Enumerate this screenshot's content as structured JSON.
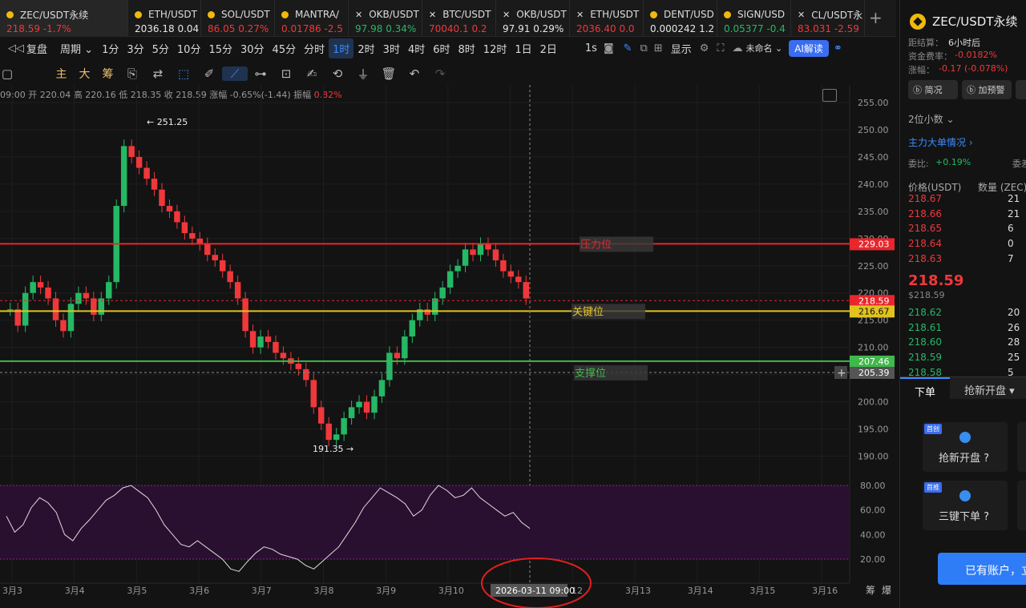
{
  "tickers": [
    {
      "name": "ZEC/USDT永续",
      "price": "218.59",
      "change": "-1.7%",
      "pc": "dn",
      "icon": "coin-icon",
      "active": true,
      "w": 160
    },
    {
      "name": "ETH/USDT",
      "price": "2036.18",
      "change": "0.04",
      "pc": "wh",
      "icon": "coin-icon",
      "w": 91
    },
    {
      "name": "SOL/USDT",
      "price": "86.05",
      "change": "0.27%",
      "pc": "dn",
      "icon": "coin-icon",
      "w": 92
    },
    {
      "name": "MANTRA/",
      "price": "0.01786",
      "change": "-2.5",
      "pc": "dn",
      "icon": "coin-icon",
      "w": 92
    },
    {
      "name": "OKB/USDT",
      "price": "97.98",
      "change": "0.34%",
      "pc": "up",
      "icon": "close-icon",
      "w": 92
    },
    {
      "name": "BTC/USDT",
      "price": "70040.1",
      "change": "0.2",
      "pc": "dn",
      "icon": "close-icon",
      "w": 92
    },
    {
      "name": "OKB/USDT",
      "price": "97.91",
      "change": "0.29%",
      "pc": "wh",
      "icon": "close-icon",
      "w": 92
    },
    {
      "name": "ETH/USDT",
      "price": "2036.40",
      "change": "0.0",
      "pc": "dn",
      "icon": "close-icon",
      "w": 92
    },
    {
      "name": "DENT/USD",
      "price": "0.000242",
      "change": "1.2",
      "pc": "wh",
      "icon": "coin-icon",
      "w": 92
    },
    {
      "name": "SIGN/USD",
      "price": "0.05377",
      "change": "-0.4",
      "pc": "up",
      "icon": "coin-icon",
      "w": 92
    },
    {
      "name": "CL/USDT永",
      "price": "83.031",
      "change": "-2.59",
      "pc": "dn",
      "icon": "close-icon",
      "w": 92
    }
  ],
  "toolbar": {
    "replay": "复盘",
    "period": "周期",
    "intervals": [
      "1分",
      "3分",
      "5分",
      "10分",
      "15分",
      "30分",
      "45分",
      "分时",
      "1时",
      "2时",
      "3时",
      "4时",
      "6时",
      "8时",
      "12时",
      "1日",
      "2日"
    ],
    "selected_interval": "1时",
    "sec": "1s",
    "display": "显示",
    "account": "未命名",
    "ai": "AI解读"
  },
  "tools": {
    "zhu": "主",
    "da": "大",
    "chou": "筹"
  },
  "ohlc": {
    "time": "09:00",
    "open_l": "开",
    "open": "220.04",
    "high_l": "高",
    "high": "220.16",
    "low_l": "低",
    "low": "218.35",
    "close_l": "收",
    "close": "218.59",
    "chg_l": "涨幅",
    "chg": "-0.65%(-1.44)",
    "amp_l": "振幅",
    "amp": "0.82%"
  },
  "chart_data": {
    "type": "candlestick",
    "y_ticks": [
      "255.00",
      "250.00",
      "245.00",
      "240.00",
      "235.00",
      "230.00",
      "225.00",
      "220.00",
      "215.00",
      "210.00",
      "205.00",
      "200.00",
      "195.00",
      "190.00"
    ],
    "x_ticks": [
      "3月3",
      "3月4",
      "3月5",
      "3月6",
      "3月7",
      "3月8",
      "3月9",
      "3月10",
      "3月11",
      "3月12",
      "3月13",
      "3月14",
      "3月15",
      "3月16"
    ],
    "visible_x_ticks": [
      "3月3",
      "3月4",
      "3月5",
      "3月6",
      "3月7",
      "3月8",
      "3月9",
      "3月10",
      "12",
      "3月13",
      "3月14",
      "3月15",
      "3月16"
    ],
    "high_mark": "← 251.25",
    "low_mark": "191.35 →",
    "close": [
      217,
      214,
      220,
      222,
      221,
      219,
      215,
      213,
      218,
      220,
      219,
      216,
      219,
      222,
      236,
      247,
      245,
      243,
      241,
      239,
      236,
      235,
      233,
      231,
      230,
      229,
      227,
      226,
      224,
      222,
      219,
      213,
      210,
      212,
      211,
      209,
      208,
      207,
      206,
      204,
      199,
      196,
      193,
      194,
      197,
      199,
      200,
      198,
      201,
      204,
      209,
      208,
      212,
      215,
      217,
      216,
      219,
      221,
      224,
      225,
      228,
      227,
      229,
      228,
      226,
      224,
      223,
      222,
      219
    ],
    "lines": [
      {
        "price": "229.03",
        "label": "压力位",
        "color": "#e8262b",
        "text_color": "#e8262b"
      },
      {
        "price": "218.59",
        "label": "",
        "color": "#e8262b",
        "dashed": true
      },
      {
        "price": "216.67",
        "label": "关键位",
        "color": "#e0c31f",
        "text_color": "#e8c52c"
      },
      {
        "price": "207.46",
        "label": "",
        "color": "#3fb94a"
      },
      {
        "price": "205.39",
        "label": "支撑位",
        "color": "#888",
        "dashed": true,
        "text_color": "#3fb94a"
      }
    ],
    "cursor_time": "2026-03-11 09:00",
    "osc_ticks": [
      "80.00",
      "60.00",
      "40.00",
      "20.00"
    ],
    "osc": [
      55,
      42,
      48,
      62,
      70,
      66,
      58,
      40,
      35,
      45,
      52,
      60,
      68,
      72,
      78,
      80,
      75,
      70,
      60,
      48,
      40,
      32,
      30,
      35,
      30,
      25,
      20,
      12,
      10,
      18,
      25,
      30,
      28,
      24,
      22,
      20,
      15,
      12,
      18,
      24,
      30,
      40,
      50,
      62,
      70,
      78,
      74,
      70,
      65,
      55,
      60,
      72,
      80,
      76,
      70,
      72,
      78,
      70,
      65,
      60,
      55,
      58,
      50,
      45
    ],
    "bottom_labels": [
      "筹",
      "爆"
    ]
  },
  "right": {
    "title": "ZEC/USDT永续",
    "settle_l": "距结算：",
    "settle": "6小时后",
    "fee_l": "资金费率：",
    "fee": "-0.0182%",
    "chg_l": "涨幅：",
    "chg": "-0.17 (-0.078%)",
    "btn1": "简况",
    "btn2": "加预警",
    "decimals": "2位小数 ⌄",
    "main": "主力大单情况 ›",
    "ratio_l": "委比:",
    "ratio": "+0.19%",
    "ratio2": "委差",
    "col_price": "价格(USDT)",
    "col_qty": "数量 (ZEC)",
    "asks": [
      [
        "218.67",
        "21"
      ],
      [
        "218.66",
        "21"
      ],
      [
        "218.65",
        "6"
      ],
      [
        "218.64",
        "0"
      ],
      [
        "218.63",
        "7"
      ]
    ],
    "last": "218.59",
    "last_sub": "$218.59",
    "bids": [
      [
        "218.62",
        "20"
      ],
      [
        "218.61",
        "26"
      ],
      [
        "218.60",
        "28"
      ],
      [
        "218.59",
        "25"
      ],
      [
        "218.58",
        "5"
      ]
    ],
    "tab_order": "下单",
    "tab_open": "抢新开盘 ▾",
    "card1_badge": "首创",
    "card1": "抢新开盘 ?",
    "card2_badge": "首推",
    "card2": "三键下单 ?",
    "account_btn": "已有账户，立"
  }
}
